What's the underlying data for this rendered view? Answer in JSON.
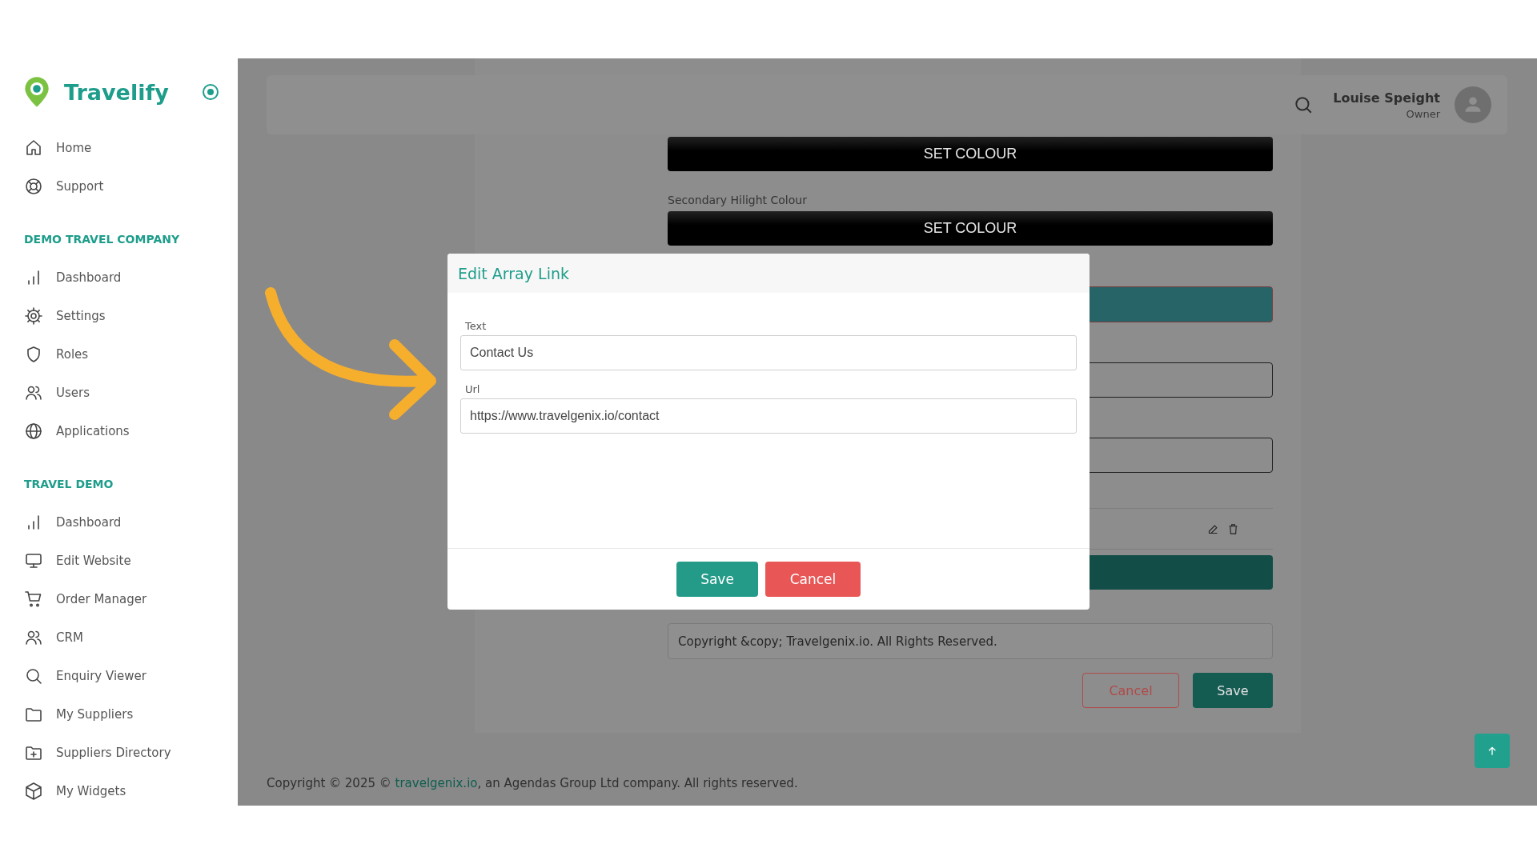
{
  "sidebar": {
    "brand": "Travelify",
    "sections": [
      {
        "items": [
          {
            "label": "Home",
            "kind": "home"
          },
          {
            "label": "Support",
            "kind": "support"
          }
        ]
      },
      {
        "heading": "DEMO TRAVEL COMPANY",
        "items": [
          {
            "label": "Dashboard",
            "kind": "chart"
          },
          {
            "label": "Settings",
            "kind": "gear"
          },
          {
            "label": "Roles",
            "kind": "shield"
          },
          {
            "label": "Users",
            "kind": "users"
          },
          {
            "label": "Applications",
            "kind": "globe"
          }
        ]
      },
      {
        "heading": "TRAVEL DEMO",
        "items": [
          {
            "label": "Dashboard",
            "kind": "chart"
          },
          {
            "label": "Edit Website",
            "kind": "monitor"
          },
          {
            "label": "Order Manager",
            "kind": "cart"
          },
          {
            "label": "CRM",
            "kind": "users"
          },
          {
            "label": "Enquiry Viewer",
            "kind": "search"
          },
          {
            "label": "My Suppliers",
            "kind": "folder"
          },
          {
            "label": "Suppliers Directory",
            "kind": "folderplus"
          },
          {
            "label": "My Widgets",
            "kind": "cube"
          }
        ]
      }
    ]
  },
  "header": {
    "user_name": "Louise Speight",
    "user_role": "Owner"
  },
  "form": {
    "rows": [
      {
        "kind": "colour_button",
        "text": "SET COLOUR"
      },
      {
        "kind": "colour_button",
        "label": "Secondary Hilight Colour",
        "text": "SET COLOUR"
      },
      {
        "kind": "swatch",
        "color": "#276468"
      },
      {
        "kind": "input"
      },
      {
        "kind": "input"
      },
      {
        "kind": "list_item"
      },
      {
        "kind": "swatch",
        "color": "#124d47"
      },
      {
        "kind": "text_input",
        "value": "Copyright &copy; Travelgenix.io. All Rights Reserved."
      }
    ],
    "buttons": [
      {
        "label": "Cancel",
        "kind": "outline"
      },
      {
        "label": "Save",
        "kind": "primary"
      }
    ]
  },
  "footer": {
    "text_before": "Copyright © 2025 ©",
    "link": "travelgenix.io",
    "text_after": ", an Agendas Group Ltd company. All rights reserved."
  },
  "modal": {
    "title": "Edit Array Link",
    "fields": [
      {
        "label": "Text",
        "value": "Contact Us"
      },
      {
        "label": "Url",
        "value": "https://www.travelgenix.io/contact"
      }
    ],
    "buttons": [
      {
        "label": "Save",
        "kind": "primary"
      },
      {
        "label": "Cancel",
        "kind": "danger"
      }
    ]
  }
}
